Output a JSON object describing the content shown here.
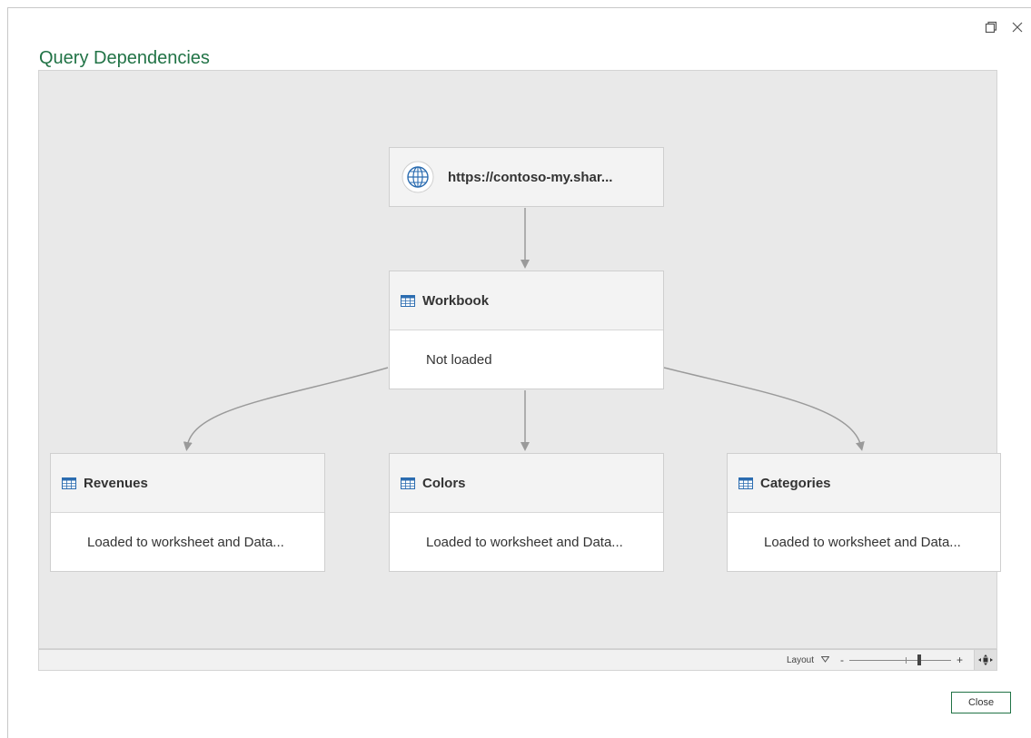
{
  "dialog": {
    "title": "Query Dependencies",
    "icons": {
      "restore": "restore-window-icon",
      "close": "close-x-icon"
    }
  },
  "nodes": {
    "source": {
      "label": "https://contoso-my.shar...",
      "icon": "globe-icon"
    },
    "workbook": {
      "label": "Workbook",
      "status": "Not loaded",
      "icon": "table-icon"
    },
    "revenues": {
      "label": "Revenues",
      "status": "Loaded to worksheet and Data...",
      "icon": "table-icon"
    },
    "colors": {
      "label": "Colors",
      "status": "Loaded to worksheet and Data...",
      "icon": "table-icon"
    },
    "categories": {
      "label": "Categories",
      "status": "Loaded to worksheet and Data...",
      "icon": "table-icon"
    }
  },
  "statusbar": {
    "layout_label": "Layout",
    "zoom_minus": "-",
    "zoom_plus": "+",
    "icons": {
      "layout_dropdown": "triangle-down-icon",
      "fit": "fit-to-screen-icon"
    }
  },
  "footer": {
    "close_label": "Close"
  },
  "colors": {
    "accent": "#217346",
    "canvas": "#e9e9e9",
    "icon_blue": "#2b6cb0"
  }
}
